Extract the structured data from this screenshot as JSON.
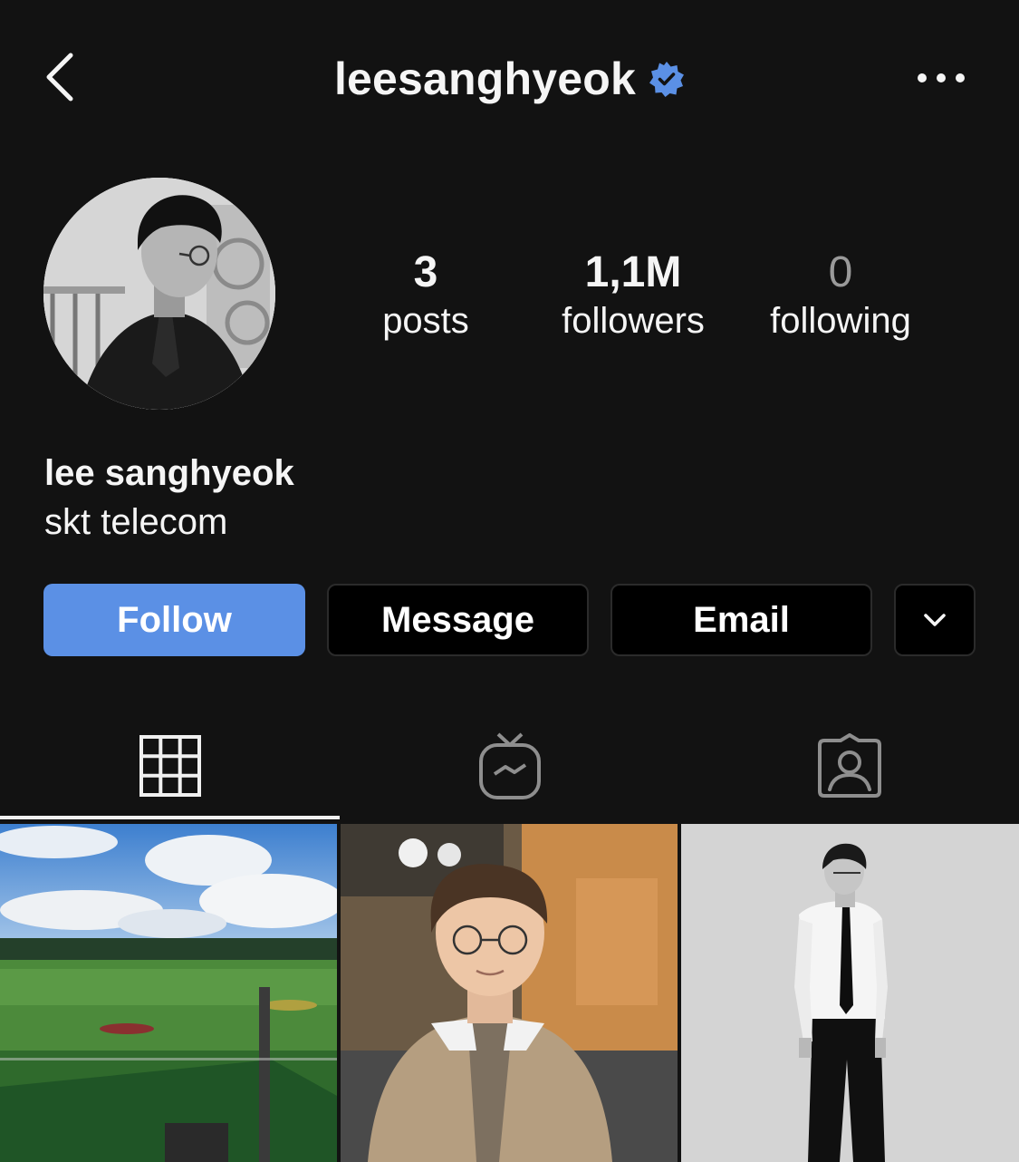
{
  "header": {
    "username": "leesanghyeok",
    "verified": true,
    "verified_color": "#5b90e5",
    "back_icon": "chevron-left-icon",
    "more_icon": "ellipsis-icon"
  },
  "profile": {
    "avatar": "profile-photo",
    "stats": [
      {
        "value": "3",
        "label": "posts"
      },
      {
        "value": "1,1M",
        "label": "followers"
      },
      {
        "value": "0",
        "label": "following"
      }
    ],
    "name": "lee sanghyeok",
    "bio": "skt telecom"
  },
  "actions": {
    "follow_label": "Follow",
    "message_label": "Message",
    "email_label": "Email",
    "more_icon": "chevron-down-icon",
    "follow_color": "#5b90e5"
  },
  "tabs": [
    {
      "icon": "grid-icon",
      "active": true
    },
    {
      "icon": "igtv-icon",
      "active": false
    },
    {
      "icon": "tagged-icon",
      "active": false
    }
  ],
  "posts": [
    {
      "subject": "golf driving range"
    },
    {
      "subject": "portrait in tweed jacket"
    },
    {
      "subject": "black and white portrait against wall"
    }
  ]
}
